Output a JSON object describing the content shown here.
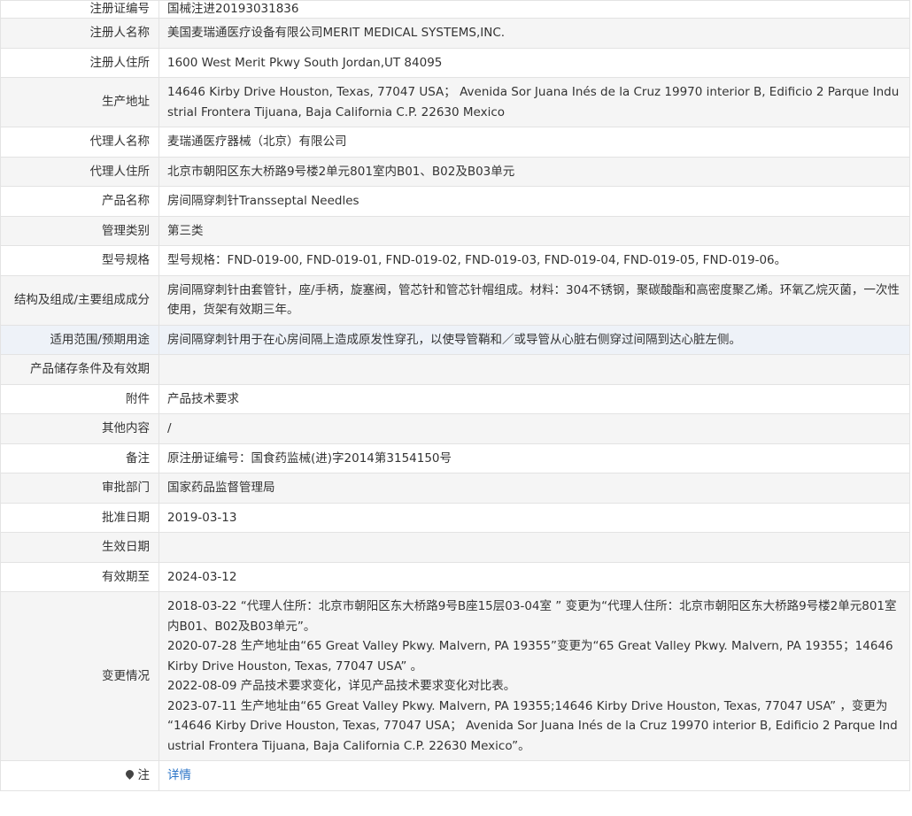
{
  "rows": [
    {
      "label": "注册证编号",
      "value": "国械注进20193031836"
    },
    {
      "label": "注册人名称",
      "value": "美国麦瑞通医疗设备有限公司MERIT MEDICAL SYSTEMS,INC."
    },
    {
      "label": "注册人住所",
      "value": "1600 West Merit Pkwy South Jordan,UT 84095"
    },
    {
      "label": "生产地址",
      "value": "14646 Kirby Drive Houston, Texas, 77047 USA； Avenida Sor Juana Inés de la Cruz 19970 interior B, Edificio 2 Parque Industrial Frontera Tijuana, Baja California C.P. 22630 Mexico"
    },
    {
      "label": "代理人名称",
      "value": "麦瑞通医疗器械（北京）有限公司"
    },
    {
      "label": "代理人住所",
      "value": "北京市朝阳区东大桥路9号楼2单元801室内B01、B02及B03单元"
    },
    {
      "label": "产品名称",
      "value": "房间隔穿刺针Transseptal Needles"
    },
    {
      "label": "管理类别",
      "value": "第三类"
    },
    {
      "label": "型号规格",
      "value": "型号规格：FND-019-00, FND-019-01, FND-019-02, FND-019-03, FND-019-04, FND-019-05, FND-019-06。"
    },
    {
      "label": "结构及组成/主要组成成分",
      "value": "房间隔穿刺针由套管针，座/手柄，旋塞阀，管芯针和管芯针帽组成。材料：304不锈钢，聚碳酸酯和高密度聚乙烯。环氧乙烷灭菌，一次性使用，货架有效期三年。"
    },
    {
      "label": "适用范围/预期用途",
      "value": "房间隔穿刺针用于在心房间隔上造成原发性穿孔，以使导管鞘和／或导管从心脏右侧穿过间隔到达心脏左侧。"
    },
    {
      "label": "产品储存条件及有效期",
      "value": ""
    },
    {
      "label": "附件",
      "value": "产品技术要求"
    },
    {
      "label": "其他内容",
      "value": "/"
    },
    {
      "label": "备注",
      "value": "原注册证编号：国食药监械(进)字2014第3154150号"
    },
    {
      "label": "审批部门",
      "value": "国家药品监督管理局"
    },
    {
      "label": "批准日期",
      "value": "2019-03-13"
    },
    {
      "label": "生效日期",
      "value": ""
    },
    {
      "label": "有效期至",
      "value": "2024-03-12"
    }
  ],
  "changes": {
    "label": "变更情况",
    "entries": [
      "2018-03-22 “代理人住所：北京市朝阳区东大桥路9号B座15层03-04室 ” 变更为“代理人住所：北京市朝阳区东大桥路9号楼2单元801室内B01、B02及B03单元”。",
      "2020-07-28 生产地址由“65 Great Valley Pkwy. Malvern, PA 19355”变更为“65 Great Valley Pkwy. Malvern, PA 19355；14646 Kirby Drive Houston, Texas, 77047 USA” 。",
      "2022-08-09 产品技术要求变化，详见产品技术要求变化对比表。",
      "2023-07-11 生产地址由“65 Great Valley Pkwy. Malvern, PA 19355;14646 Kirby Drive Houston, Texas, 77047 USA” ，变更为 “14646 Kirby Drive Houston, Texas, 77047 USA； Avenida Sor Juana Inés de la Cruz 19970 interior B, Edificio 2 Parque Industrial Frontera Tijuana, Baja California C.P. 22630 Mexico”。"
    ]
  },
  "note": {
    "label": "注",
    "link_text": "详情",
    "icon": "pin-icon"
  }
}
